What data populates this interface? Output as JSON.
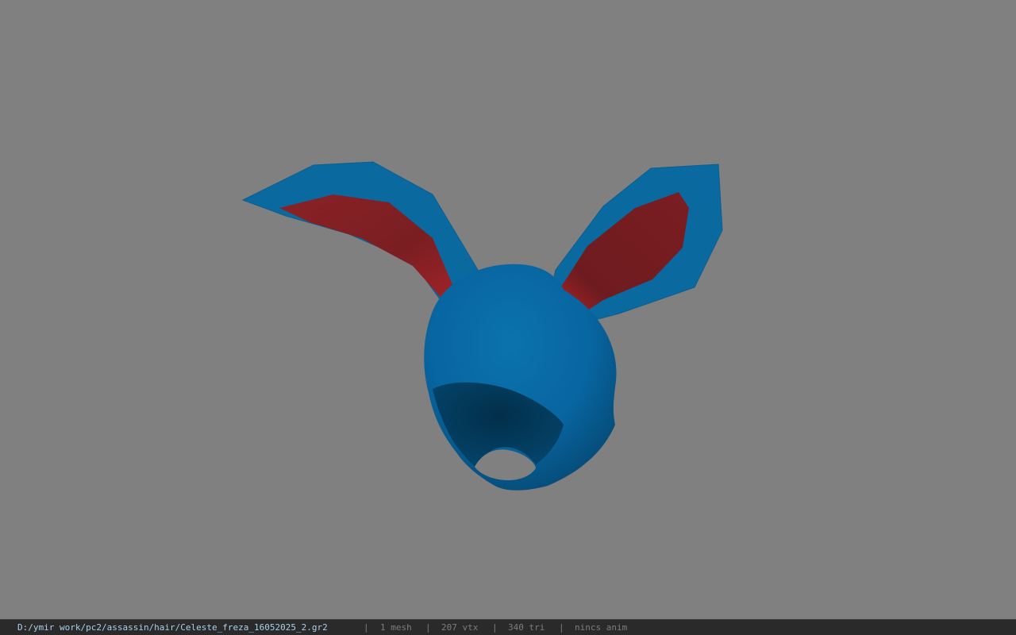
{
  "viewport": {
    "background_color": "#808080",
    "model": {
      "description_name": "bunny-ear-hood-mesh",
      "colors": {
        "hood_blue": "#0a6aa0",
        "hood_dark": "#063d5c",
        "ear_inner_red": "#7a1e22",
        "ear_inner_highlight": "#c0282c"
      }
    }
  },
  "status_bar": {
    "file_path": "D:/ymir work/pc2/assassin/hair/Celeste_freza_16052025_2.gr2",
    "separator": "|",
    "mesh_count": "1 mesh",
    "vertex_count": "207 vtx",
    "triangle_count": "340 tri",
    "animation_status": "nincs anim",
    "colors": {
      "background": "#2a2a2a",
      "path_text": "#a9d1ea",
      "meta_text": "#7d7d7d"
    }
  }
}
